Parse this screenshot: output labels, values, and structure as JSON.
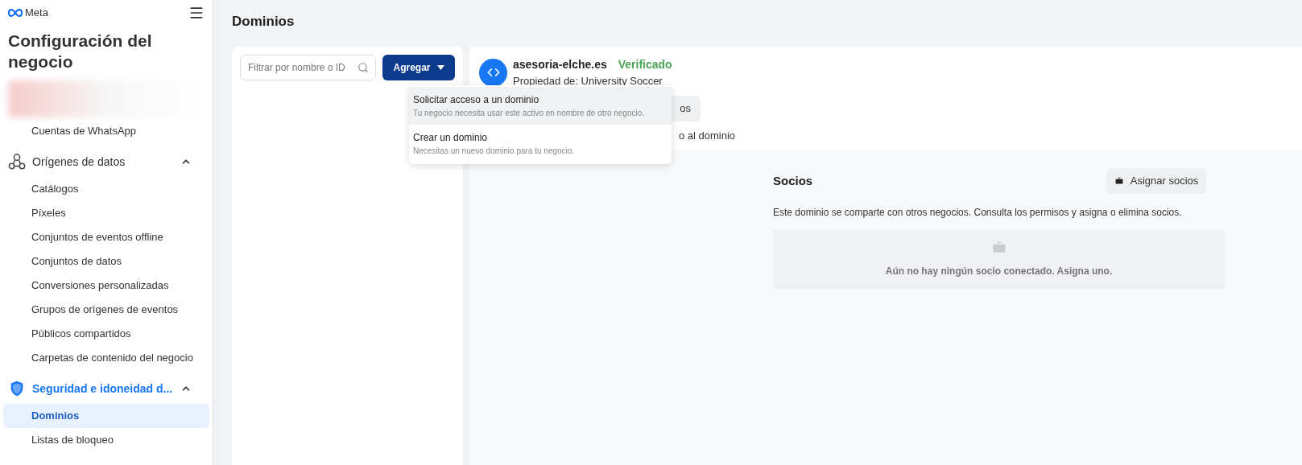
{
  "sidebar": {
    "brand": "Meta",
    "title": "Configuración del negocio",
    "top_items": [
      {
        "label": "Cuentas de WhatsApp",
        "selected": false
      }
    ],
    "groups": [
      {
        "label": "Orígenes de datos",
        "kind": "data",
        "active": false,
        "expanded": true,
        "items": [
          {
            "label": "Catálogos",
            "selected": false
          },
          {
            "label": "Píxeles",
            "selected": false
          },
          {
            "label": "Conjuntos de eventos offline",
            "selected": false
          },
          {
            "label": "Conjuntos de datos",
            "selected": false
          },
          {
            "label": "Conversiones personalizadas",
            "selected": false
          },
          {
            "label": "Grupos de orígenes de eventos",
            "selected": false
          },
          {
            "label": "Públicos compartidos",
            "selected": false
          },
          {
            "label": "Carpetas de contenido del negocio",
            "selected": false
          }
        ]
      },
      {
        "label": "Seguridad e idoneidad d...",
        "kind": "security",
        "active": true,
        "expanded": true,
        "items": [
          {
            "label": "Dominios",
            "selected": true
          },
          {
            "label": "Listas de bloqueo",
            "selected": false
          }
        ]
      }
    ]
  },
  "main": {
    "title": "Dominios",
    "filter": {
      "placeholder": "Filtrar por nombre o ID"
    },
    "add_button": {
      "label": "Agregar"
    },
    "menu": [
      {
        "title": "Solicitar acceso a un dominio",
        "description": "Tu negocio necesita usar este activo en nombre de otro negocio.",
        "selected": true
      },
      {
        "title": "Crear un dominio",
        "description": "Necesitas un nuevo dominio para tu negocio.",
        "selected": false
      }
    ],
    "domain": {
      "name": "asesoria-elche.es",
      "status": "Verificado",
      "owner": "Propiedad de: University Soccer",
      "button_fragment": "os",
      "text_fragment": "o al dominio"
    },
    "partners": {
      "title": "Socios",
      "button": "Asignar socios",
      "description": "Este dominio se comparte con otros negocios. Consulta los permisos y asigna o elimina socios.",
      "empty_text": "Aún no hay ningún socio conectado. Asigna uno."
    }
  }
}
